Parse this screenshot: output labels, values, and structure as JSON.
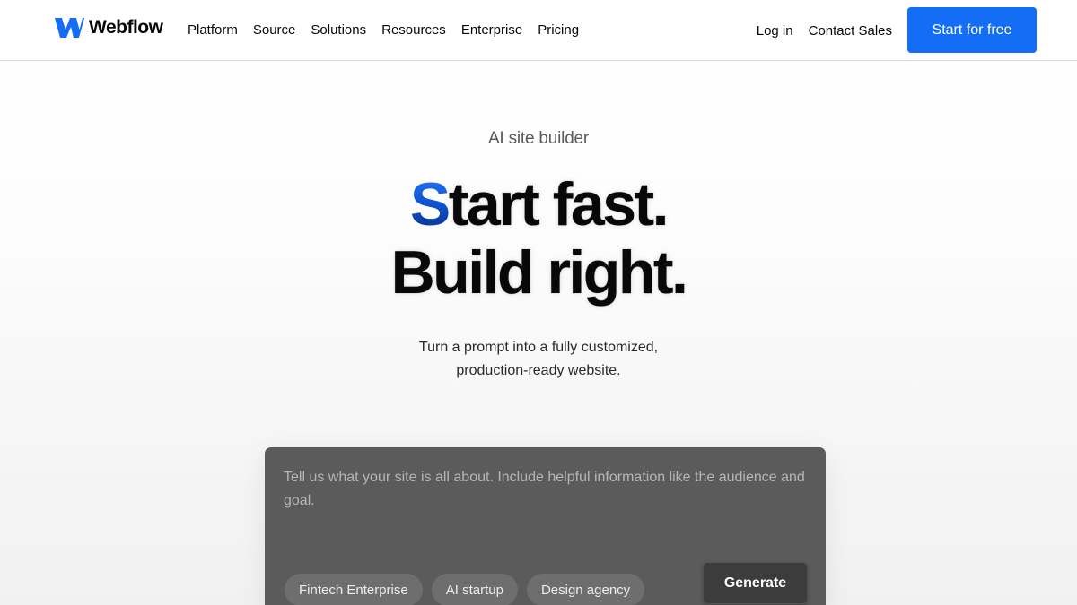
{
  "nav": {
    "logo_text": "Webflow",
    "links": [
      "Platform",
      "Source",
      "Solutions",
      "Resources",
      "Enterprise",
      "Pricing"
    ],
    "login": "Log in",
    "contact": "Contact Sales",
    "cta": "Start for free"
  },
  "hero": {
    "eyebrow": "AI site builder",
    "headline_accent": "S",
    "headline_line1_rest": "tart fast.",
    "headline_line2": "Build right.",
    "subtitle_line1": "Turn a prompt into a fully customized,",
    "subtitle_line2": "production-ready website."
  },
  "prompt": {
    "placeholder": "Tell us what your site is all about. Include helpful information like the audience and goal.",
    "chips": [
      "Fintech Enterprise",
      "AI startup",
      "Design agency"
    ],
    "generate": "Generate"
  },
  "colors": {
    "brand_blue": "#146ef5",
    "text": "#080808",
    "prompt_bg": "#5b5b5b"
  }
}
